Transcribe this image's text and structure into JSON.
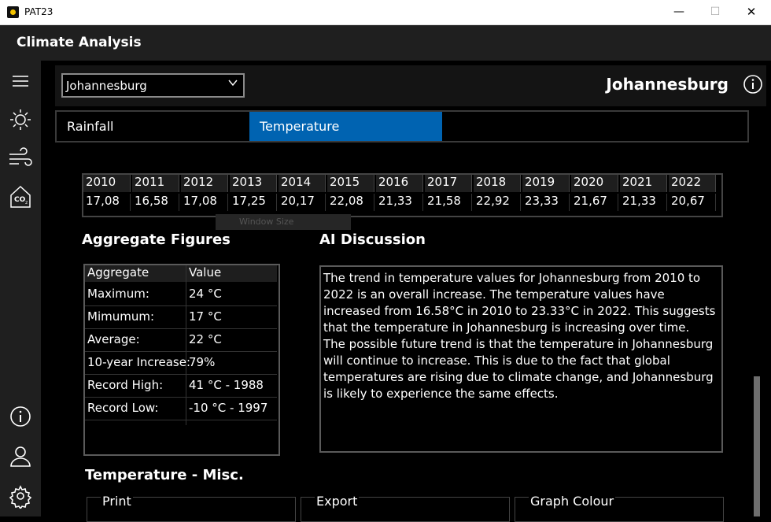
{
  "window": {
    "title": "PAT23",
    "minimize": "—",
    "maximize": "☐",
    "close": "✕"
  },
  "app": {
    "title": "Climate Analysis"
  },
  "rail": {
    "icons": [
      "menu-icon",
      "sun-icon",
      "wind-icon",
      "co2-icon",
      "info-icon",
      "user-icon",
      "settings-icon"
    ]
  },
  "location": {
    "selected": "Johannesburg",
    "title": "Johannesburg"
  },
  "tabs": [
    {
      "label": "Rainfall"
    },
    {
      "label": "Temperature",
      "active": true
    }
  ],
  "colors": {
    "accent": "#0063b1",
    "rail": "#1f1f1f",
    "background": "#000000"
  },
  "years": {
    "headers": [
      "2010",
      "2011",
      "2012",
      "2013",
      "2014",
      "2015",
      "2016",
      "2017",
      "2018",
      "2019",
      "2020",
      "2021",
      "2022"
    ],
    "values": [
      "17,08",
      "16,58",
      "17,08",
      "17,25",
      "20,17",
      "22,08",
      "21,33",
      "21,58",
      "22,92",
      "23,33",
      "21,67",
      "21,33",
      "20,67"
    ]
  },
  "ghost_text": "Window Size",
  "aggregate": {
    "title": "Aggregate Figures",
    "col_aggregate": "Aggregate",
    "col_value": "Value",
    "rows": [
      {
        "label": "Maximum:",
        "value": "24 °C"
      },
      {
        "label": "Mimumum:",
        "value": "17 °C"
      },
      {
        "label": "Average:",
        "value": "22 °C"
      },
      {
        "label": "10-year Increase:",
        "value": "79%"
      },
      {
        "label": "Record High:",
        "value": "41 °C - 1988"
      },
      {
        "label": "Record Low:",
        "value": "-10 °C - 1997"
      }
    ]
  },
  "ai": {
    "title": "AI Discussion",
    "para1": "The trend in temperature values for Johannesburg from 2010 to 2022 is an overall increase. The temperature values have increased from 16.58°C in 2010 to 23.33°C in 2022. This suggests that the temperature in Johannesburg is increasing over time.",
    "para2": "The possible future trend is that the temperature in Johannesburg will continue to increase. This is due to the fact that global temperatures are rising due to climate change, and Johannesburg is likely to experience the same effects."
  },
  "misc": {
    "title": "Temperature - Misc.",
    "print": "Print",
    "export": "Export",
    "graph_colour": "Graph Colour"
  }
}
